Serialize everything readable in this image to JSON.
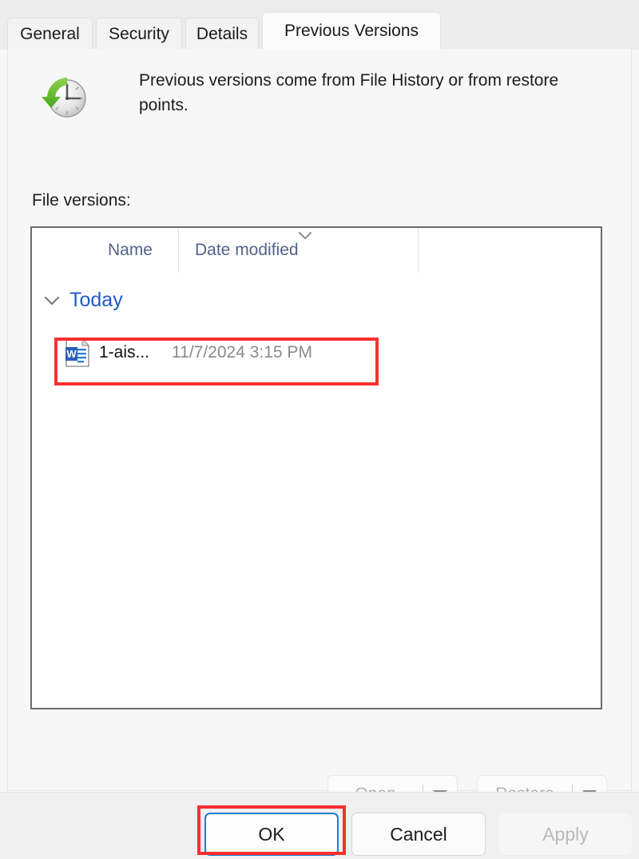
{
  "dialog": {
    "tabs": [
      {
        "id": "general",
        "label": "General",
        "active": false
      },
      {
        "id": "security",
        "label": "Security",
        "active": false
      },
      {
        "id": "details",
        "label": "Details",
        "active": false
      },
      {
        "id": "previous",
        "label": "Previous Versions",
        "active": true
      }
    ]
  },
  "header": {
    "icon": "clock-restore-icon",
    "description": "Previous versions come from File History or from restore points."
  },
  "file_versions": {
    "label": "File versions:",
    "columns": [
      {
        "id": "name",
        "label": "Name",
        "sorted": false
      },
      {
        "id": "date",
        "label": "Date modified",
        "sorted": true,
        "sort_direction": "descending"
      },
      {
        "id": "blank",
        "label": ""
      }
    ],
    "groups": [
      {
        "label": "Today",
        "expanded": true,
        "chevron": "chevron-down-icon",
        "items": [
          {
            "icon": "word-document-icon",
            "name": "1-ais...",
            "date_modified": "11/7/2024 3:15 PM",
            "highlighted": true
          }
        ]
      }
    ]
  },
  "actions": {
    "open": {
      "label": "Open",
      "enabled": false,
      "has_dropdown": true
    },
    "restore": {
      "label": "Restore",
      "enabled": false,
      "has_dropdown": true
    }
  },
  "footer": {
    "ok": {
      "label": "OK",
      "default": true,
      "enabled": true
    },
    "cancel": {
      "label": "Cancel",
      "enabled": true
    },
    "apply": {
      "label": "Apply",
      "enabled": false
    }
  },
  "annotations": {
    "color": "#fc3030",
    "boxes": [
      {
        "target": "file-row"
      },
      {
        "target": "ok-button"
      }
    ]
  }
}
